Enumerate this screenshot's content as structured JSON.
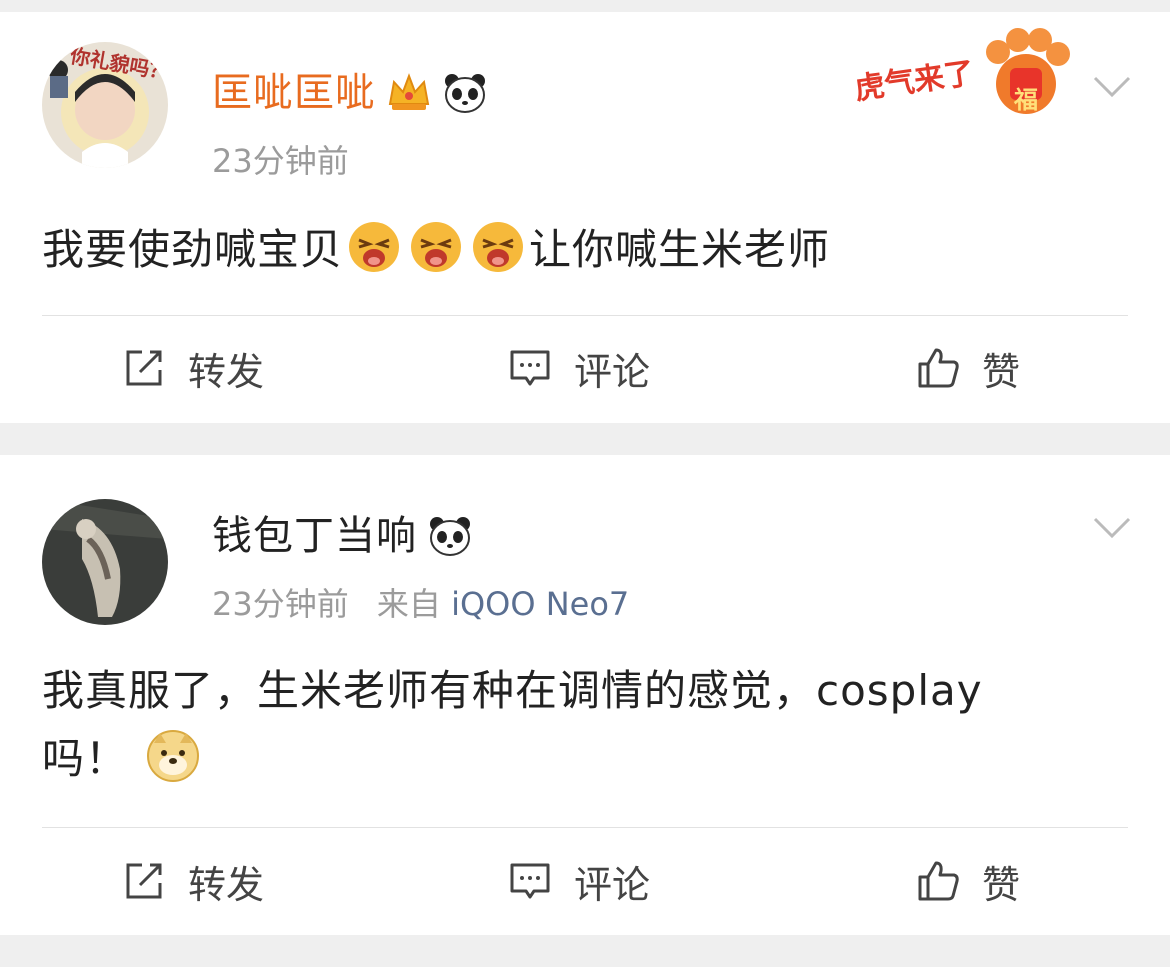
{
  "posts": [
    {
      "username": "匡呲匡呲",
      "time": "23分钟前",
      "source_prefix": "",
      "device": "",
      "content_parts": [
        "我要使劲喊宝贝",
        "让你喊生米老师"
      ],
      "avatar_overlay_text": "你礼貌吗？",
      "banner_text": "虎气来了",
      "banner_badge": "福",
      "actions": {
        "repost": "转发",
        "comment": "评论",
        "like": "赞"
      }
    },
    {
      "username": "钱包丁当响",
      "time": "23分钟前",
      "source_prefix": "来自",
      "device": "iQOO Neo7",
      "content_line1": "我真服了，生米老师有种在调情的感觉，cosplay",
      "content_line2": "吗！",
      "actions": {
        "repost": "转发",
        "comment": "评论",
        "like": "赞"
      }
    }
  ],
  "colors": {
    "vip_name": "#e86b1f",
    "normal_name": "#222222",
    "meta_gray": "#9b9b9b",
    "device_blue": "#5a6f91",
    "separator": "#efefef"
  },
  "icons": [
    "crown-icon",
    "panda-icon",
    "crying-emoji-icon",
    "doge-emoji-icon",
    "repost-icon",
    "comment-icon",
    "like-icon",
    "chevron-down-icon"
  ]
}
